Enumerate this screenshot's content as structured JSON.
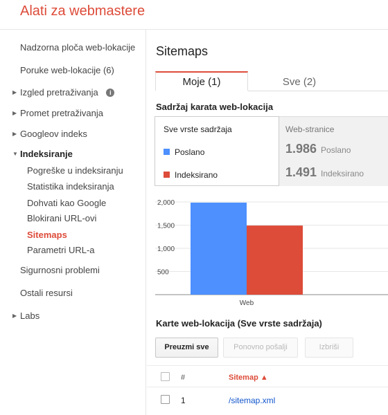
{
  "app": {
    "title": "Alati za webmastere"
  },
  "sidebar": {
    "items": [
      {
        "label": "Nadzorna ploča web-lokacije"
      },
      {
        "label": "Poruke web-lokacije (6)"
      },
      {
        "label": "Izgled pretraživanja",
        "icon": "info-icon"
      },
      {
        "label": "Promet pretraživanja"
      },
      {
        "label": "Googleov indeks"
      },
      {
        "label": "Indeksiranje"
      },
      {
        "label": "Sigurnosni problemi"
      },
      {
        "label": "Ostali resursi"
      },
      {
        "label": "Labs"
      }
    ],
    "subitems": [
      {
        "label": "Pogreške u indeksiranju"
      },
      {
        "label": "Statistika indeksiranja"
      },
      {
        "label": "Dohvati kao Google"
      },
      {
        "label": "Blokirani URL-ovi"
      },
      {
        "label": "Sitemaps"
      },
      {
        "label": "Parametri URL-a"
      }
    ]
  },
  "main": {
    "title": "Sitemaps",
    "tabs": [
      {
        "label": "Moje (1)"
      },
      {
        "label": "Sve (2)"
      }
    ],
    "content_section_title": "Sadržaj karata web-lokacija",
    "legend": {
      "header": "Sve vrste sadržaja",
      "items": [
        {
          "label": "Poslano",
          "color": "#4d90fe"
        },
        {
          "label": "Indeksirano",
          "color": "#dd4b39"
        }
      ]
    },
    "stats": {
      "header": "Web-stranice",
      "rows": [
        {
          "value": "1.986",
          "label": "Poslano"
        },
        {
          "value": "1.491",
          "label": "Indeksirano"
        }
      ]
    },
    "list_title": "Karte web-lokacija (Sve vrste sadržaja)",
    "buttons": {
      "download_all": "Preuzmi sve",
      "resubmit": "Ponovno pošalji",
      "delete": "Izbriši"
    },
    "table": {
      "columns": {
        "num": "#",
        "sitemap": "Sitemap ▲"
      },
      "rows": [
        {
          "num": "1",
          "sitemap": "/sitemap.xml"
        }
      ]
    }
  },
  "chart_data": {
    "type": "bar",
    "categories": [
      "Web"
    ],
    "series": [
      {
        "name": "Poslano",
        "values": [
          1986
        ],
        "color": "#4d90fe"
      },
      {
        "name": "Indeksirano",
        "values": [
          1491
        ],
        "color": "#dd4b39"
      }
    ],
    "yticks": [
      "2,000",
      "1,500",
      "1,000",
      "500"
    ],
    "ytick_values": [
      2000,
      1500,
      1000,
      500
    ],
    "ylim": [
      0,
      2000
    ]
  }
}
